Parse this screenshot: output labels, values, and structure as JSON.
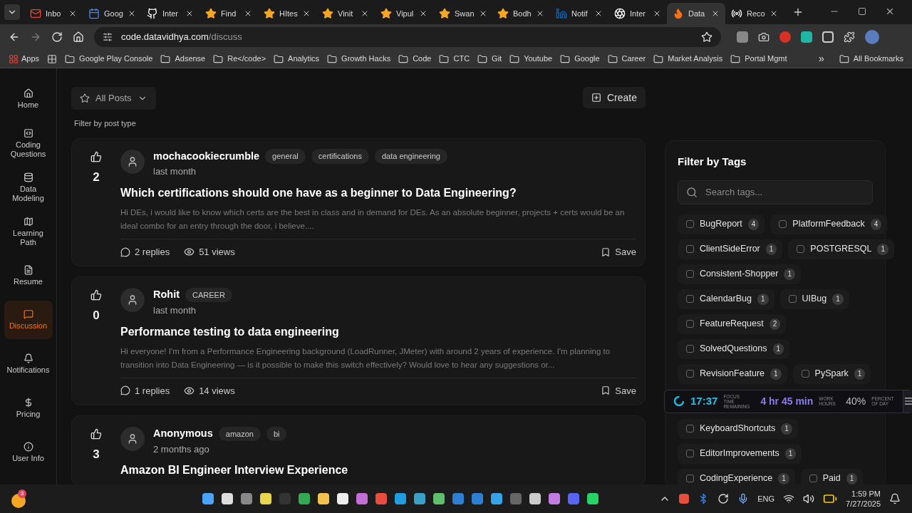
{
  "browser": {
    "tabs": [
      {
        "title": "Inbo",
        "kind": "mail",
        "selected": false
      },
      {
        "title": "Goog",
        "kind": "calendar",
        "selected": false
      },
      {
        "title": "Inter",
        "kind": "github",
        "selected": false
      },
      {
        "title": "Find",
        "kind": "star",
        "selected": false
      },
      {
        "title": "HItes",
        "kind": "star",
        "selected": false
      },
      {
        "title": "Vinit",
        "kind": "star",
        "selected": false
      },
      {
        "title": "Vipul",
        "kind": "star",
        "selected": false
      },
      {
        "title": "Swan",
        "kind": "star",
        "selected": false
      },
      {
        "title": "Bodh",
        "kind": "star",
        "selected": false
      },
      {
        "title": "Notif",
        "kind": "linkedin",
        "selected": false
      },
      {
        "title": "Inter",
        "kind": "openai",
        "selected": false
      },
      {
        "title": "Data",
        "kind": "site",
        "selected": true
      },
      {
        "title": "Reco",
        "kind": "rec",
        "selected": false
      }
    ],
    "address": {
      "host": "code.datavidhya.com",
      "path": "/discuss"
    },
    "bookmarks": {
      "apps": "Apps",
      "folders": [
        "Google Play Console",
        "Adsense",
        "Re</code>",
        "Analytics",
        "Growth Hacks",
        "Code",
        "CTC",
        "Git",
        "Youtube",
        "Google",
        "Career",
        "Market Analysis",
        "Portal Mgmt"
      ],
      "more": "»",
      "all": "All Bookmarks"
    }
  },
  "sidebar": {
    "items": [
      {
        "label": "Home",
        "selected": false
      },
      {
        "label": "Coding Questions",
        "selected": false
      },
      {
        "label": "Data Modeling",
        "selected": false
      },
      {
        "label": "Learning Path",
        "selected": false
      },
      {
        "label": "Resume",
        "selected": false
      },
      {
        "label": "Discussion",
        "selected": true
      },
      {
        "label": "Notifications",
        "selected": false
      },
      {
        "label": "Pricing",
        "selected": false
      },
      {
        "label": "User Info",
        "selected": false
      }
    ]
  },
  "toolbar": {
    "filter": "All Posts",
    "filter_hint": "Filter by post type",
    "create": "Create"
  },
  "posts": [
    {
      "votes": "2",
      "author": "mochacookiecrumble",
      "tags": [
        "general",
        "certifications",
        "data engineering"
      ],
      "time": "last month",
      "title": "Which certifications should one have as a beginner to Data Engineering?",
      "excerpt": "Hi DEs, i would like to know which certs are the best in class and in demand for DEs. As an absolute beginner, projects + certs would be an ideal combo for an entry through the door, i believe....",
      "replies": "2 replies",
      "views": "51 views",
      "save": "Save"
    },
    {
      "votes": "0",
      "author": "Rohit",
      "tags": [
        "CAREER"
      ],
      "time": "last month",
      "title": "Performance testing to data engineering",
      "excerpt": "Hi everyone! I'm from a Performance Engineering background (LoadRunner, JMeter) with around 2 years of experience. I'm planning to transition into Data Engineering — is it possible to make this switch effectively? Would love to hear any suggestions or...",
      "replies": "1 replies",
      "views": "14 views",
      "save": "Save"
    },
    {
      "votes": "3",
      "author": "Anonymous",
      "tags": [
        "amazon",
        "bi"
      ],
      "time": "2 months ago",
      "title": "Amazon BI Engineer Interview Experience"
    }
  ],
  "tags_panel": {
    "title": "Filter by Tags",
    "search_placeholder": "Search tags...",
    "rows": [
      [
        {
          "name": "BugReport",
          "count": "4",
          "checked": false
        },
        {
          "name": "PlatformFeedback",
          "count": "4",
          "checked": false
        }
      ],
      [
        {
          "name": "ClientSideError",
          "count": "1",
          "checked": false
        },
        {
          "name": "POSTGRESQL",
          "count": "1",
          "checked": false
        }
      ],
      [
        {
          "name": "Consistent-Shopper",
          "count": "1",
          "checked": false
        }
      ],
      [
        {
          "name": "CalendarBug",
          "count": "1",
          "checked": false
        },
        {
          "name": "UIBug",
          "count": "1",
          "checked": false
        }
      ],
      [
        {
          "name": "FeatureRequest",
          "count": "2",
          "checked": false
        }
      ],
      [
        {
          "name": "SolvedQuestions",
          "count": "1",
          "checked": false
        }
      ],
      [
        {
          "name": "RevisionFeature",
          "count": "1",
          "checked": false
        },
        {
          "name": "PySpark",
          "count": "1",
          "checked": false
        }
      ],
      [
        {
          "name": "KeyboardShortcuts",
          "count": "1",
          "checked": false
        }
      ],
      [
        {
          "name": "EditorImprovements",
          "count": "1",
          "checked": false
        }
      ],
      [
        {
          "name": "CodingExperience",
          "count": "1",
          "checked": false
        },
        {
          "name": "Paid",
          "count": "1",
          "checked": false
        }
      ]
    ]
  },
  "focus_widget": {
    "time": "17:37",
    "time_label": "FOCUS TIME REMAINING",
    "hours": "4 hr 45 min",
    "hours_label": "WORK HOURS",
    "percent": "40%",
    "percent_label": "PERCENT OF DAY"
  },
  "taskbar": {
    "badge": "3",
    "language": "ENG",
    "time": "1:59 PM",
    "date": "7/27/2025"
  }
}
